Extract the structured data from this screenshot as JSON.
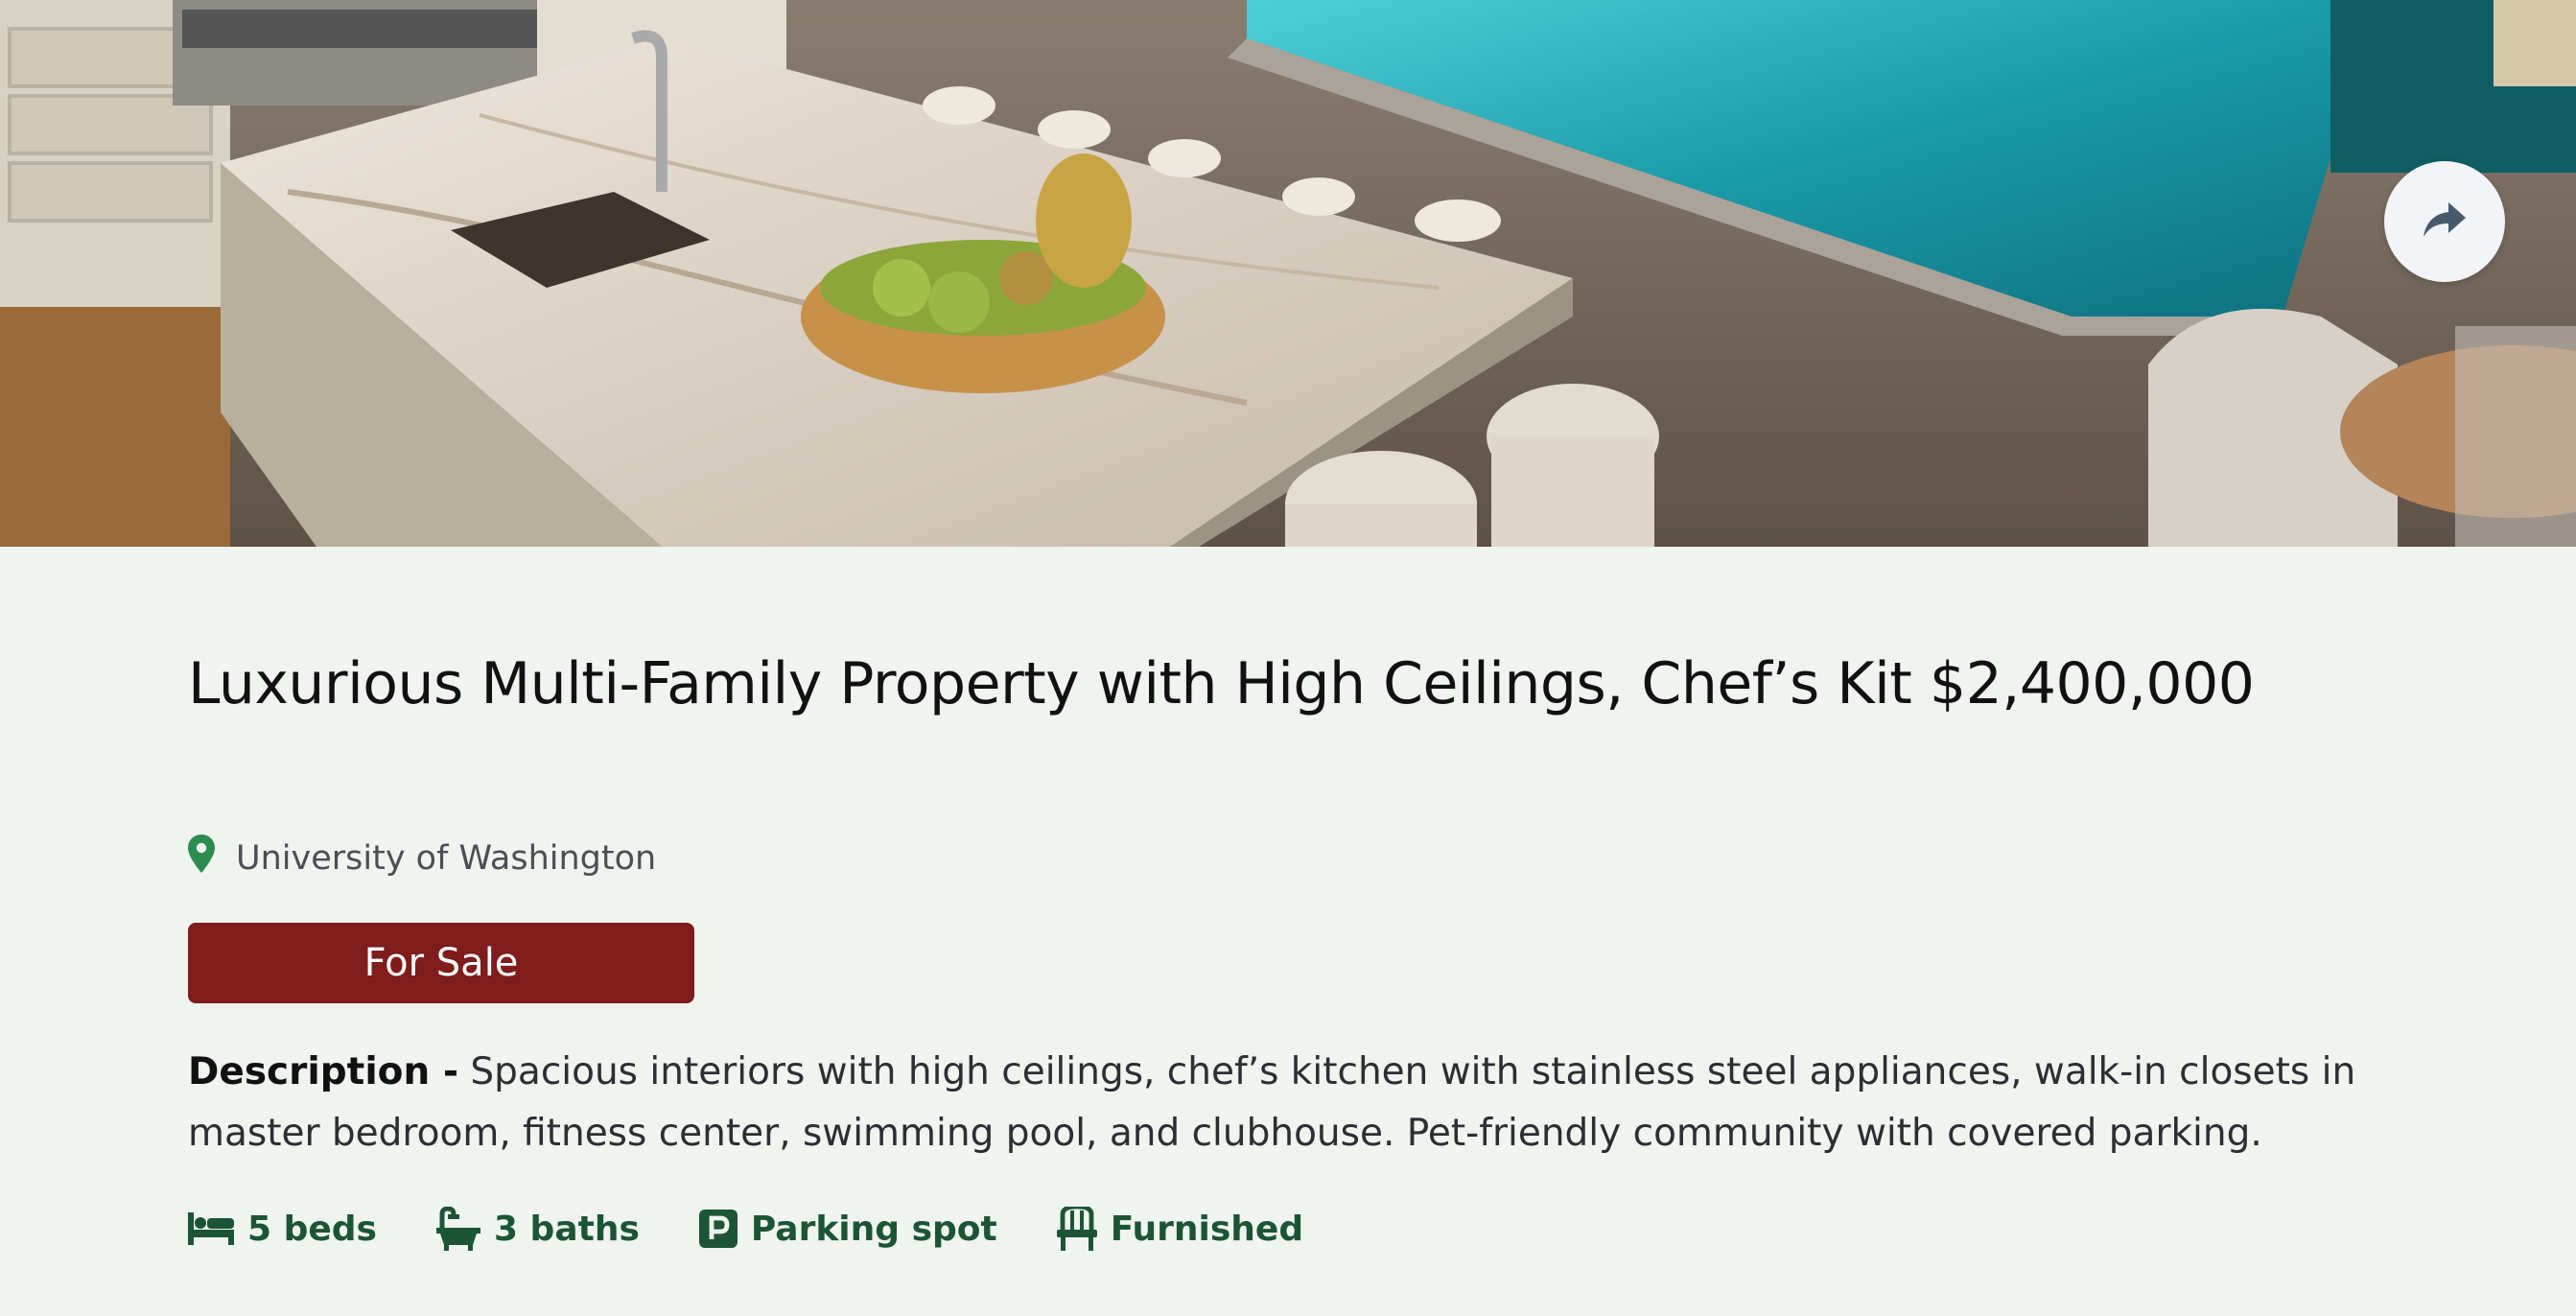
{
  "listing": {
    "title": "Luxurious Multi-Family Property with High Ceilings, Chef’s Kit $2,400,000",
    "location": "University of Washington",
    "status": "For Sale",
    "description_label": "Description -",
    "description": " Spacious interiors with high ceilings, chef’s kitchen with stainless steel appliances, walk-in closets in master bedroom, fitness center, swimming pool, and clubhouse. Pet-friendly community with covered parking."
  },
  "features": [
    {
      "icon": "bed-icon",
      "label": "5 beds"
    },
    {
      "icon": "bathtub-icon",
      "label": "3 baths"
    },
    {
      "icon": "parking-icon",
      "label": "Parking spot"
    },
    {
      "icon": "chair-icon",
      "label": "Furnished"
    }
  ],
  "colors": {
    "page_background": "#eff4ef",
    "status_badge": "#7f1c1c",
    "feature_text": "#1c5535",
    "location_pin": "#2e8b4f"
  },
  "hero_image": {
    "alt": "kitchen-island-and-pool"
  },
  "share_icon": "share-icon"
}
